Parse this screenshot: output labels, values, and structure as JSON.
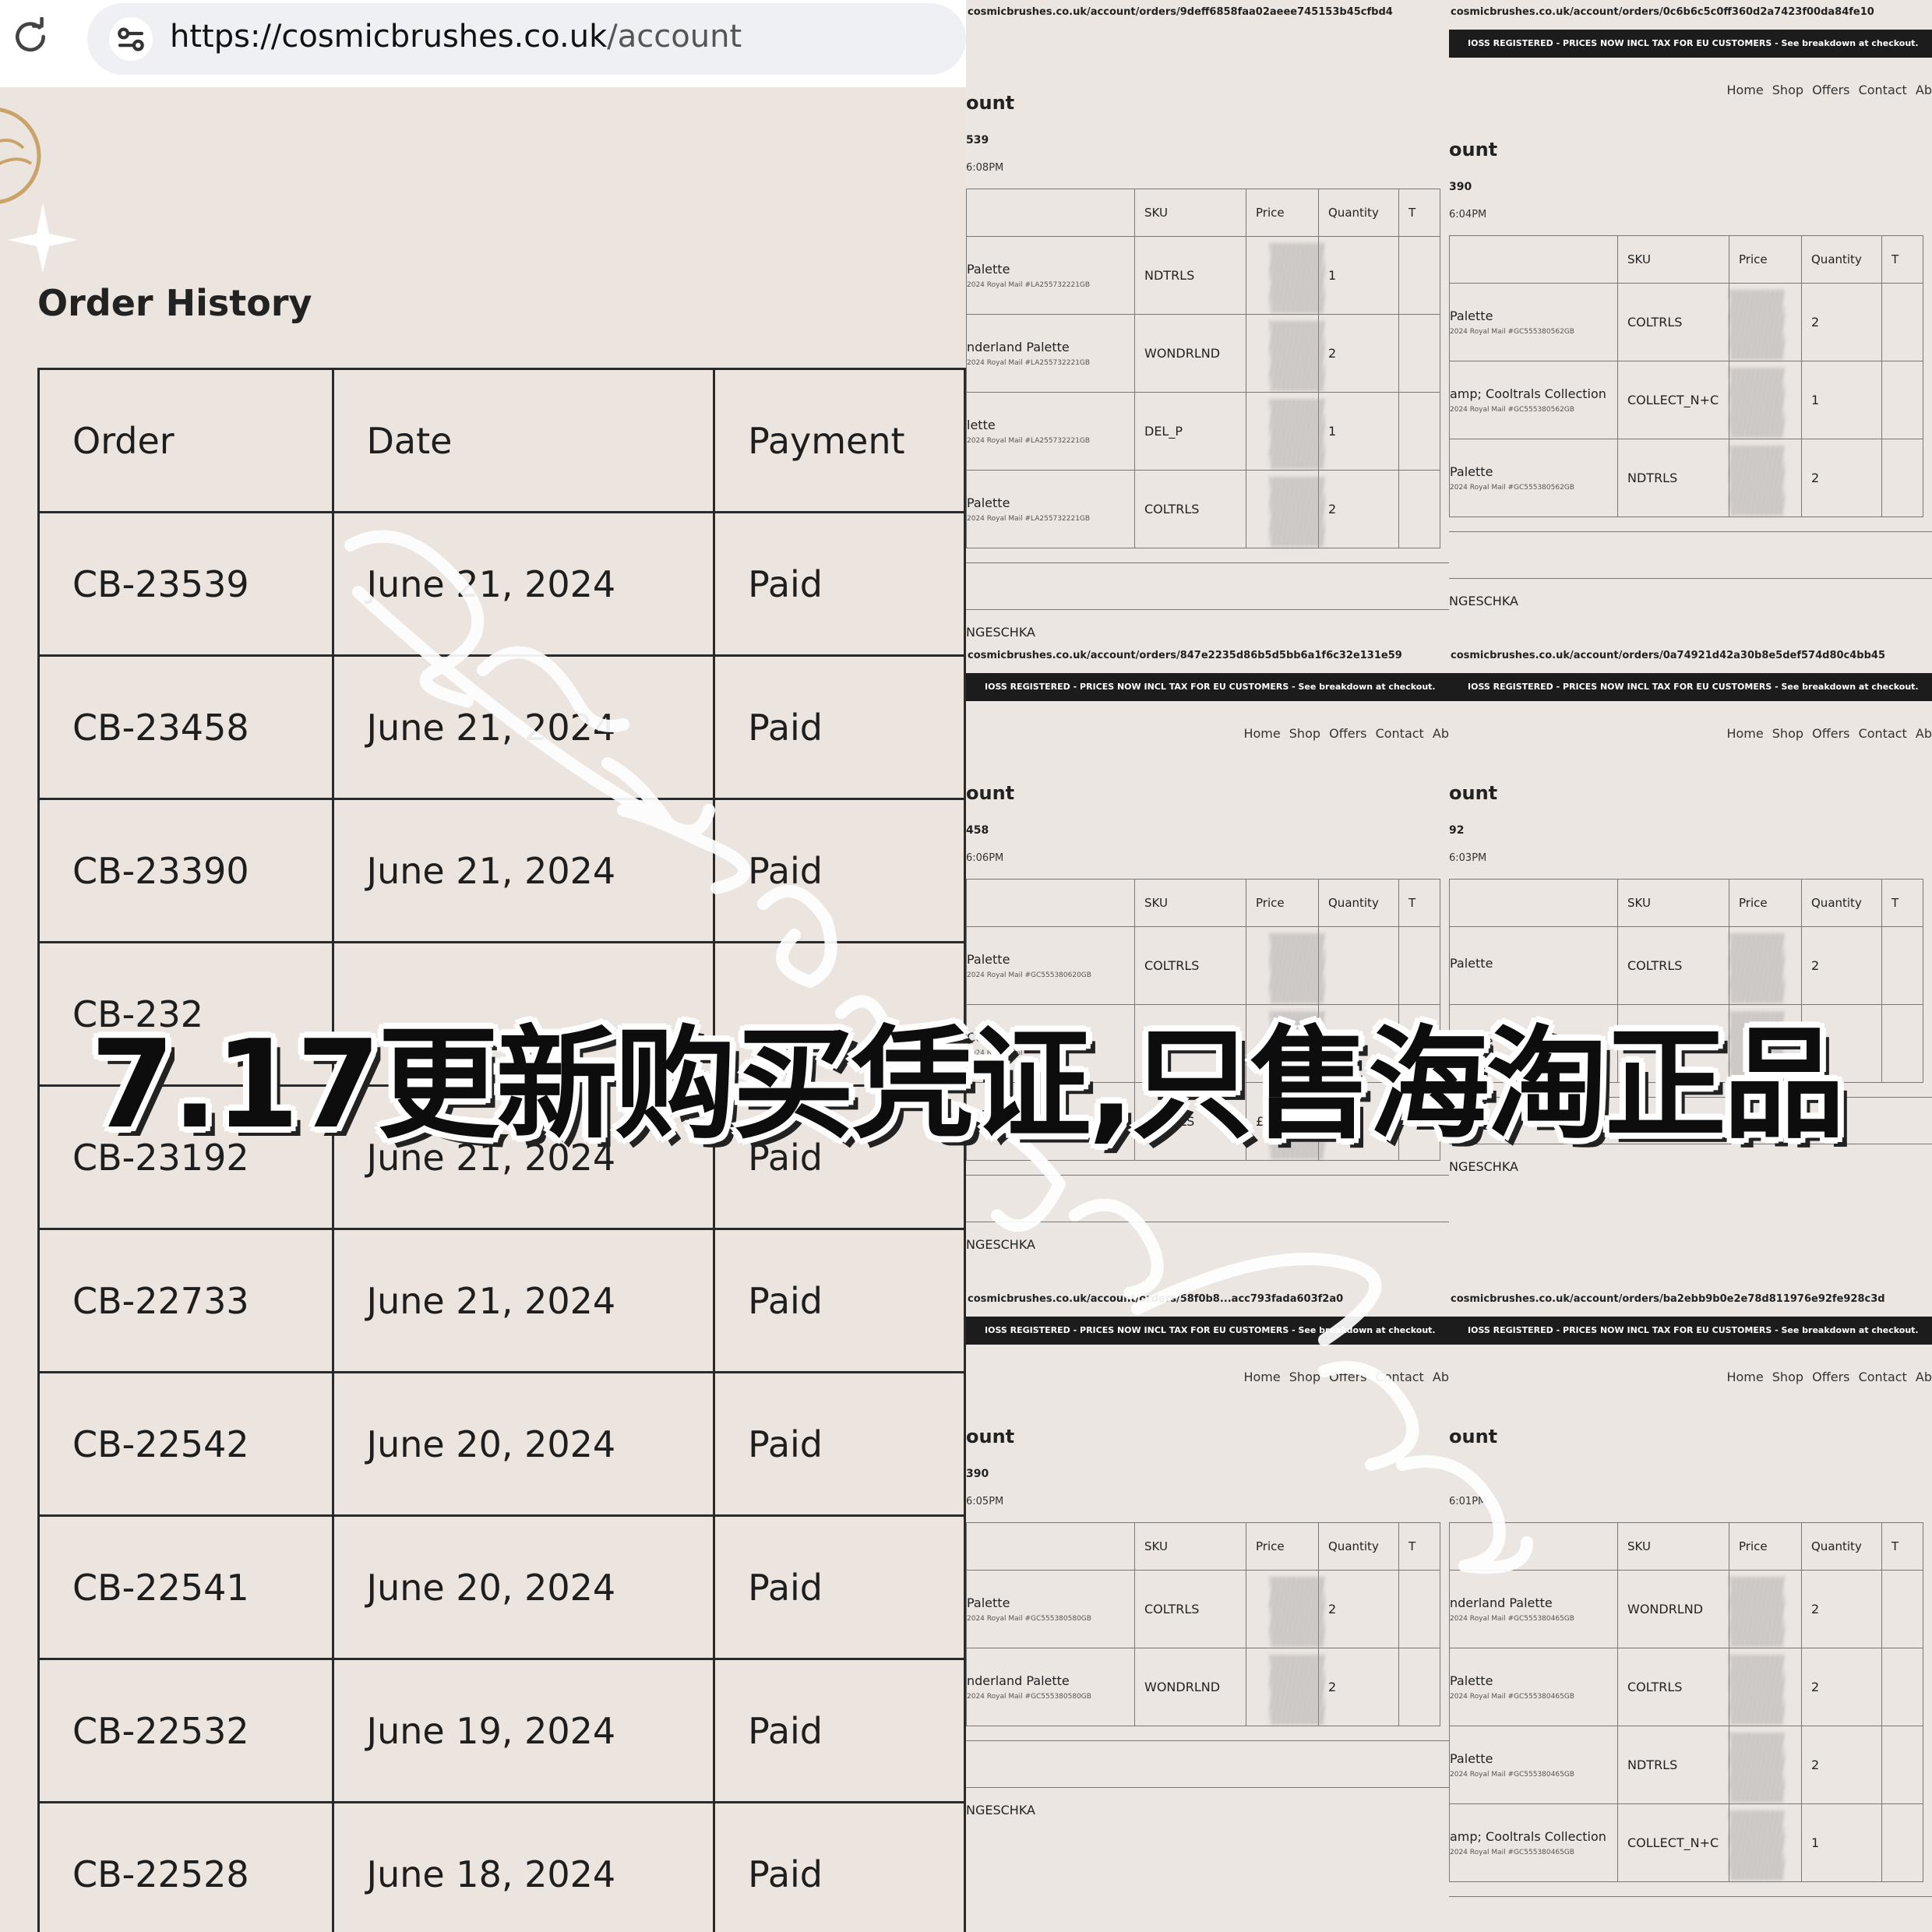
{
  "browser": {
    "url_host": "https://cosmicbrushes.co.uk",
    "url_path": "/account"
  },
  "account": {
    "title": "Order History",
    "columns": [
      "Order",
      "Date",
      "Payment"
    ],
    "orders": [
      {
        "order": "CB-23539",
        "date": "June 21, 2024",
        "payment": "Paid"
      },
      {
        "order": "CB-23458",
        "date": "June 21, 2024",
        "payment": "Paid"
      },
      {
        "order": "CB-23390",
        "date": "June 21, 2024",
        "payment": "Paid"
      },
      {
        "order": "CB-232",
        "date": "",
        "payment": ""
      },
      {
        "order": "CB-23192",
        "date": "June 21, 2024",
        "payment": "Paid"
      },
      {
        "order": "CB-22733",
        "date": "June 21, 2024",
        "payment": "Paid"
      },
      {
        "order": "CB-22542",
        "date": "June 20, 2024",
        "payment": "Paid"
      },
      {
        "order": "CB-22541",
        "date": "June 20, 2024",
        "payment": "Paid"
      },
      {
        "order": "CB-22532",
        "date": "June 19, 2024",
        "payment": "Paid"
      },
      {
        "order": "CB-22528",
        "date": "June 18, 2024",
        "payment": "Paid"
      }
    ]
  },
  "receipts": {
    "banner": "IOSS REGISTERED - PRICES NOW INCL TAX FOR EU CUSTOMERS - See breakdown at checkout.",
    "nav": "Home Shop Offers Contact Ab",
    "headers": [
      "SKU",
      "Price",
      "Quantity",
      "T"
    ],
    "panels": [
      {
        "url": "cosmicbrushes.co.uk/account/orders/9deff6858faa02aeee745153b45cfbd4",
        "acc": "ount",
        "num": "539",
        "time": "6:08PM",
        "rows": [
          {
            "name": "Palette",
            "ship": "2024 Royal Mail #LA255732221GB",
            "sku": "NDTRLS",
            "qty": "1"
          },
          {
            "name": "nderland Palette",
            "ship": "2024 Royal Mail #LA255732221GB",
            "sku": "WONDRLND",
            "qty": "2"
          },
          {
            "name": "lette",
            "ship": "2024 Royal Mail #LA255732221GB",
            "sku": "DEL_P",
            "qty": "1"
          },
          {
            "name": "Palette",
            "ship": "2024 Royal Mail #LA255732221GB",
            "sku": "COLTRLS",
            "qty": "2"
          }
        ],
        "foot": "NGESCHKA"
      },
      {
        "url": "cosmicbrushes.co.uk/account/orders/0c6b6c5c0ff360d2a7423f00da84fe10",
        "acc": "ount",
        "num": "390",
        "time": "6:04PM",
        "rows": [
          {
            "name": "Palette",
            "ship": "2024 Royal Mail #GC555380562GB",
            "sku": "COLTRLS",
            "qty": "2"
          },
          {
            "name": "amp; Cooltrals Collection",
            "ship": "2024 Royal Mail #GC555380562GB",
            "sku": "COLLECT_N+C",
            "qty": "1"
          },
          {
            "name": "Palette",
            "ship": "2024 Royal Mail #GC555380562GB",
            "sku": "NDTRLS",
            "qty": "2"
          }
        ],
        "foot": "NGESCHKA"
      },
      {
        "url": "cosmicbrushes.co.uk/account/orders/847e2235d86b5d5bb6a1f6c32e131e59",
        "acc": "ount",
        "num": "458",
        "time": "6:06PM",
        "rows": [
          {
            "name": "Palette",
            "ship": "2024 Royal Mail #GC555380620GB",
            "sku": "COLTRLS",
            "qty": ""
          },
          {
            "name": "Collection",
            "ship": "2024 Royal Mail",
            "sku": "",
            "qty": ""
          },
          {
            "name": "Palette",
            "ship": "2024 Royal Mail #GC555380620GB",
            "sku": "NDTRLS",
            "price": "£28.00",
            "qty": "1"
          }
        ],
        "foot": "NGESCHKA"
      },
      {
        "url": "cosmicbrushes.co.uk/account/orders/0a74921d42a30b8e5def574d80c4bb45",
        "acc": "ount",
        "num": "92",
        "time": "6:03PM",
        "rows": [
          {
            "name": "Palette",
            "ship": "",
            "sku": "COLTRLS",
            "qty": "2"
          },
          {
            "name": "Palette",
            "ship": "",
            "sku": "",
            "qty": "2"
          }
        ],
        "foot": "NGESCHKA"
      },
      {
        "url": "cosmicbrushes.co.uk/account/orders/58f0b8...acc793fada603f2a0",
        "acc": "ount",
        "num": "390",
        "time": "6:05PM",
        "rows": [
          {
            "name": "Palette",
            "ship": "2024 Royal Mail #GC555380580GB",
            "sku": "COLTRLS",
            "qty": "2"
          },
          {
            "name": "nderland Palette",
            "ship": "2024 Royal Mail #GC555380580GB",
            "sku": "WONDRLND",
            "qty": "2"
          }
        ],
        "foot": "NGESCHKA"
      },
      {
        "url": "cosmicbrushes.co.uk/account/orders/ba2ebb9b0e2e78d811976e92fe928c3d",
        "acc": "ount",
        "num": "",
        "time": "6:01PM",
        "rows": [
          {
            "name": "nderland Palette",
            "ship": "2024 Royal Mail #GC555380465GB",
            "sku": "WONDRLND",
            "qty": "2"
          },
          {
            "name": "Palette",
            "ship": "2024 Royal Mail #GC555380465GB",
            "sku": "COLTRLS",
            "qty": "2"
          },
          {
            "name": "Palette",
            "ship": "2024 Royal Mail #GC555380465GB",
            "sku": "NDTRLS",
            "qty": "2"
          },
          {
            "name": "amp; Cooltrals Collection",
            "ship": "2024 Royal Mail #GC555380465GB",
            "sku": "COLLECT_N+C",
            "qty": "1"
          }
        ],
        "foot": "NGESCHKA"
      }
    ]
  },
  "overlay": {
    "caption": "7.17更新购买凭证,只售海淘正品",
    "watermark": "nini cosmetics"
  }
}
